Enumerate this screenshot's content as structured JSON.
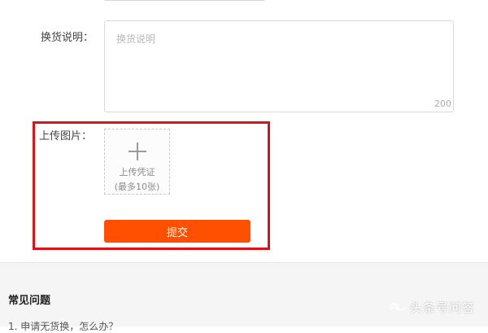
{
  "form": {
    "description": {
      "label": "换货说明：",
      "placeholder": "换货说明",
      "value": "",
      "char_limit": "200"
    },
    "upload": {
      "label": "上传图片：",
      "button_line1": "上传凭证",
      "button_line2": "(最多10张)",
      "icon": "plus-icon"
    },
    "submit_label": "提交"
  },
  "faq": {
    "title": "常见问题",
    "first_item": "1. 申请无货换，怎么办？"
  },
  "watermark": {
    "text": "头条号问答",
    "icon": "toutiao-logo"
  },
  "colors": {
    "primary_button": "#ff4f00",
    "highlight_border": "#d8141b",
    "faq_background": "#f5f5f5"
  }
}
